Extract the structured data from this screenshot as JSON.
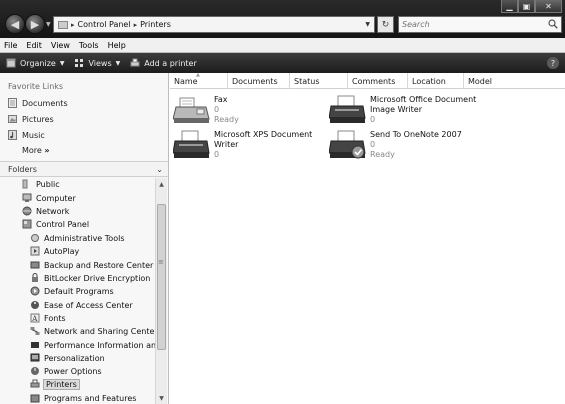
{
  "window": {
    "address": {
      "crumbs": [
        "Control Panel",
        "Printers"
      ]
    },
    "search": {
      "placeholder": "Search"
    }
  },
  "menu": [
    "File",
    "Edit",
    "View",
    "Tools",
    "Help"
  ],
  "toolbar": {
    "organize": "Organize",
    "views": "Views",
    "add_printer": "Add a printer"
  },
  "favorites": {
    "title": "Favorite Links",
    "items": [
      "Documents",
      "Pictures",
      "Music"
    ],
    "more": "More"
  },
  "folders": {
    "title": "Folders",
    "items": [
      "Public",
      "Computer",
      "Network",
      "Control Panel",
      "Administrative Tools",
      "AutoPlay",
      "Backup and Restore Center",
      "BitLocker Drive Encryption",
      "Default Programs",
      "Ease of Access Center",
      "Fonts",
      "Network and Sharing Center",
      "Performance Information and",
      "Personalization",
      "Power Options",
      "Printers",
      "Programs and Features"
    ],
    "selected": "Printers"
  },
  "columns": [
    "Name",
    "Documents",
    "Status",
    "Comments",
    "Location",
    "Model"
  ],
  "printers": [
    {
      "name": "Fax",
      "docs": "0",
      "status": "Ready"
    },
    {
      "name": "Microsoft Office Document Image Writer",
      "docs": "0",
      "status": ""
    },
    {
      "name": "Microsoft XPS Document Writer",
      "docs": "0",
      "status": ""
    },
    {
      "name": "Send To OneNote 2007",
      "docs": "0",
      "status": "Ready"
    }
  ],
  "colors": {
    "chrome_dark": "#1c1c1c",
    "pane_bg": "#f7f7f7",
    "meta_text": "#888888"
  },
  "icons": [
    "back-arrow-icon",
    "forward-arrow-icon",
    "folder-icon",
    "refresh-icon",
    "search-icon",
    "organize-icon",
    "views-icon",
    "printer-icon",
    "help-icon"
  ]
}
